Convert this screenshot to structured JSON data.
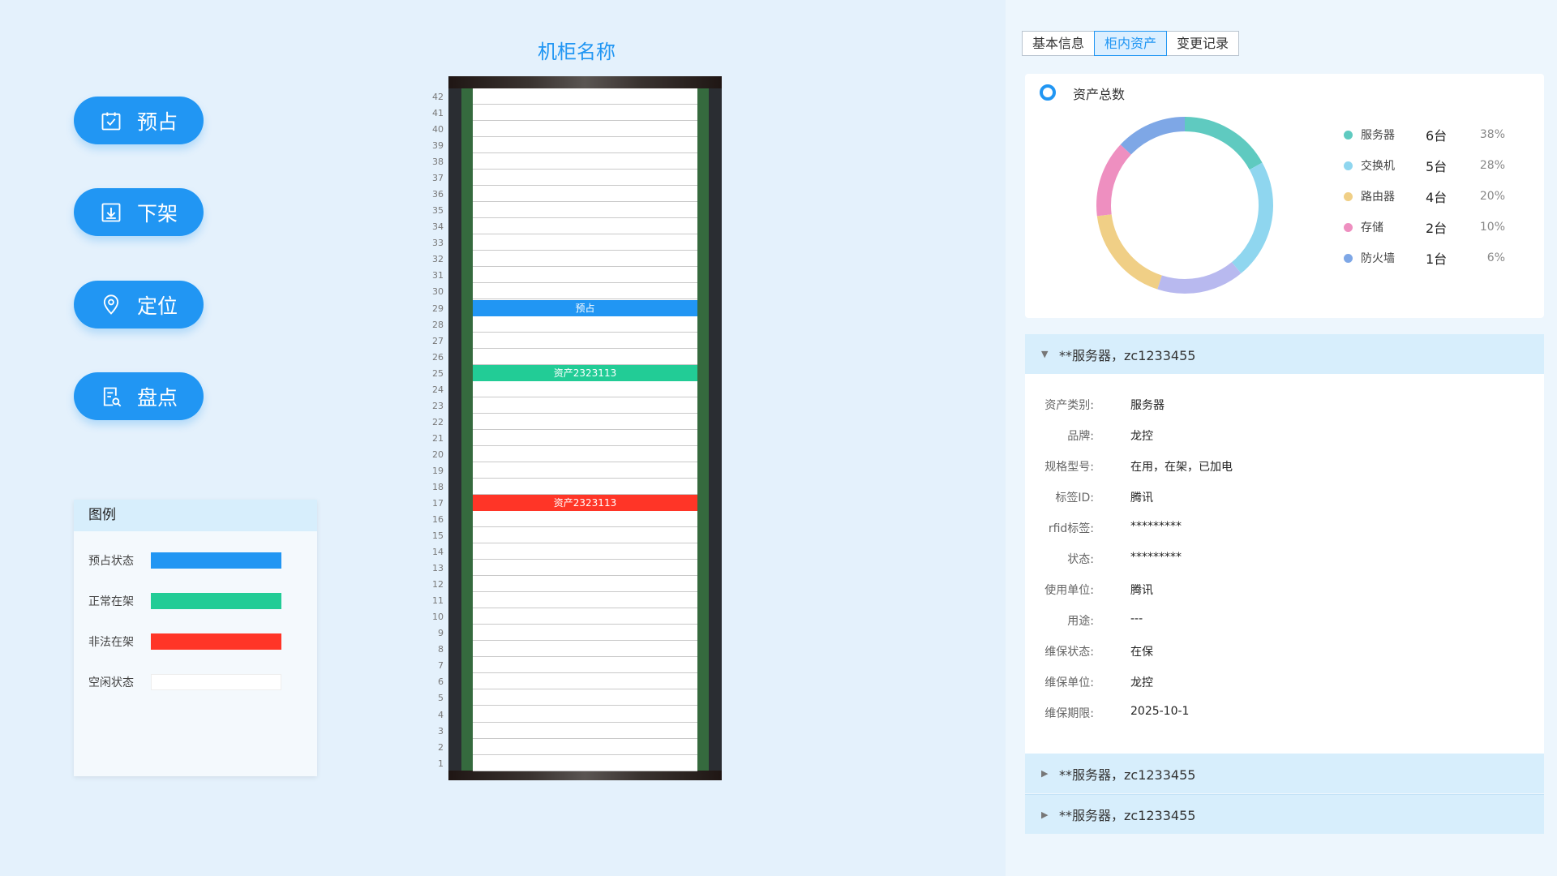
{
  "actions": [
    {
      "label": "预占",
      "icon": "calendar-check-icon"
    },
    {
      "label": "下架",
      "icon": "download-tray-icon"
    },
    {
      "label": "定位",
      "icon": "location-pin-icon"
    },
    {
      "label": "盘点",
      "icon": "document-search-icon"
    }
  ],
  "legend": {
    "title": "图例",
    "items": [
      {
        "label": "预占状态",
        "color": "#2196f3"
      },
      {
        "label": "正常在架",
        "color": "#22cc96"
      },
      {
        "label": "非法在架",
        "color": "#ff3527"
      },
      {
        "label": "空闲状态",
        "color": "#ffffff"
      }
    ]
  },
  "rack": {
    "title": "机柜名称",
    "unit_count": 42,
    "occupied": [
      {
        "unit": 29,
        "label": "预占",
        "color": "#2196f3"
      },
      {
        "unit": 25,
        "label": "资产2323113",
        "color": "#22cc96"
      },
      {
        "unit": 17,
        "label": "资产2323113",
        "color": "#ff3527"
      }
    ]
  },
  "tabs": [
    {
      "label": "基本信息",
      "active": false
    },
    {
      "label": "柜内资产",
      "active": true
    },
    {
      "label": "变更记录",
      "active": false
    }
  ],
  "stats": {
    "title": "资产总数",
    "items": [
      {
        "name": "服务器",
        "count": "6台",
        "pct": "38%",
        "color": "#5fcac0"
      },
      {
        "name": "交换机",
        "count": "5台",
        "pct": "28%",
        "color": "#8fd6ef"
      },
      {
        "name": "路由器",
        "count": "4台",
        "pct": "20%",
        "color": "#f0cf86"
      },
      {
        "name": "存储",
        "count": "2台",
        "pct": "10%",
        "color": "#ee8fc0"
      },
      {
        "name": "防火墙",
        "count": "1台",
        "pct": "6%",
        "color": "#7ea7e6"
      }
    ],
    "donut_segments": [
      {
        "color": "#5fcac0",
        "pct": 17
      },
      {
        "color": "#8fd6ef",
        "pct": 22
      },
      {
        "color": "#b8b9ef",
        "pct": 16
      },
      {
        "color": "#f0cf86",
        "pct": 18
      },
      {
        "color": "#ee8fc0",
        "pct": 14
      },
      {
        "color": "#7ea7e6",
        "pct": 13
      }
    ]
  },
  "assets": [
    {
      "header": "**服务器，zc1233455",
      "expanded": true,
      "fields": [
        {
          "k": "资产类别:",
          "v": "服务器"
        },
        {
          "k": "品牌:",
          "v": "龙控"
        },
        {
          "k": "规格型号:",
          "v": "在用，在架，已加电"
        },
        {
          "k": "标签ID:",
          "v": "腾讯"
        },
        {
          "k": "rfid标签:",
          "v": "*********"
        },
        {
          "k": "状态:",
          "v": "*********"
        },
        {
          "k": "使用单位:",
          "v": "腾讯"
        },
        {
          "k": "用途:",
          "v": "---"
        },
        {
          "k": "维保状态:",
          "v": "在保"
        },
        {
          "k": "维保单位:",
          "v": "龙控"
        },
        {
          "k": "维保期限:",
          "v": "2025-10-1"
        }
      ]
    },
    {
      "header": "**服务器，zc1233455",
      "expanded": false
    },
    {
      "header": "**服务器，zc1233455",
      "expanded": false
    }
  ]
}
